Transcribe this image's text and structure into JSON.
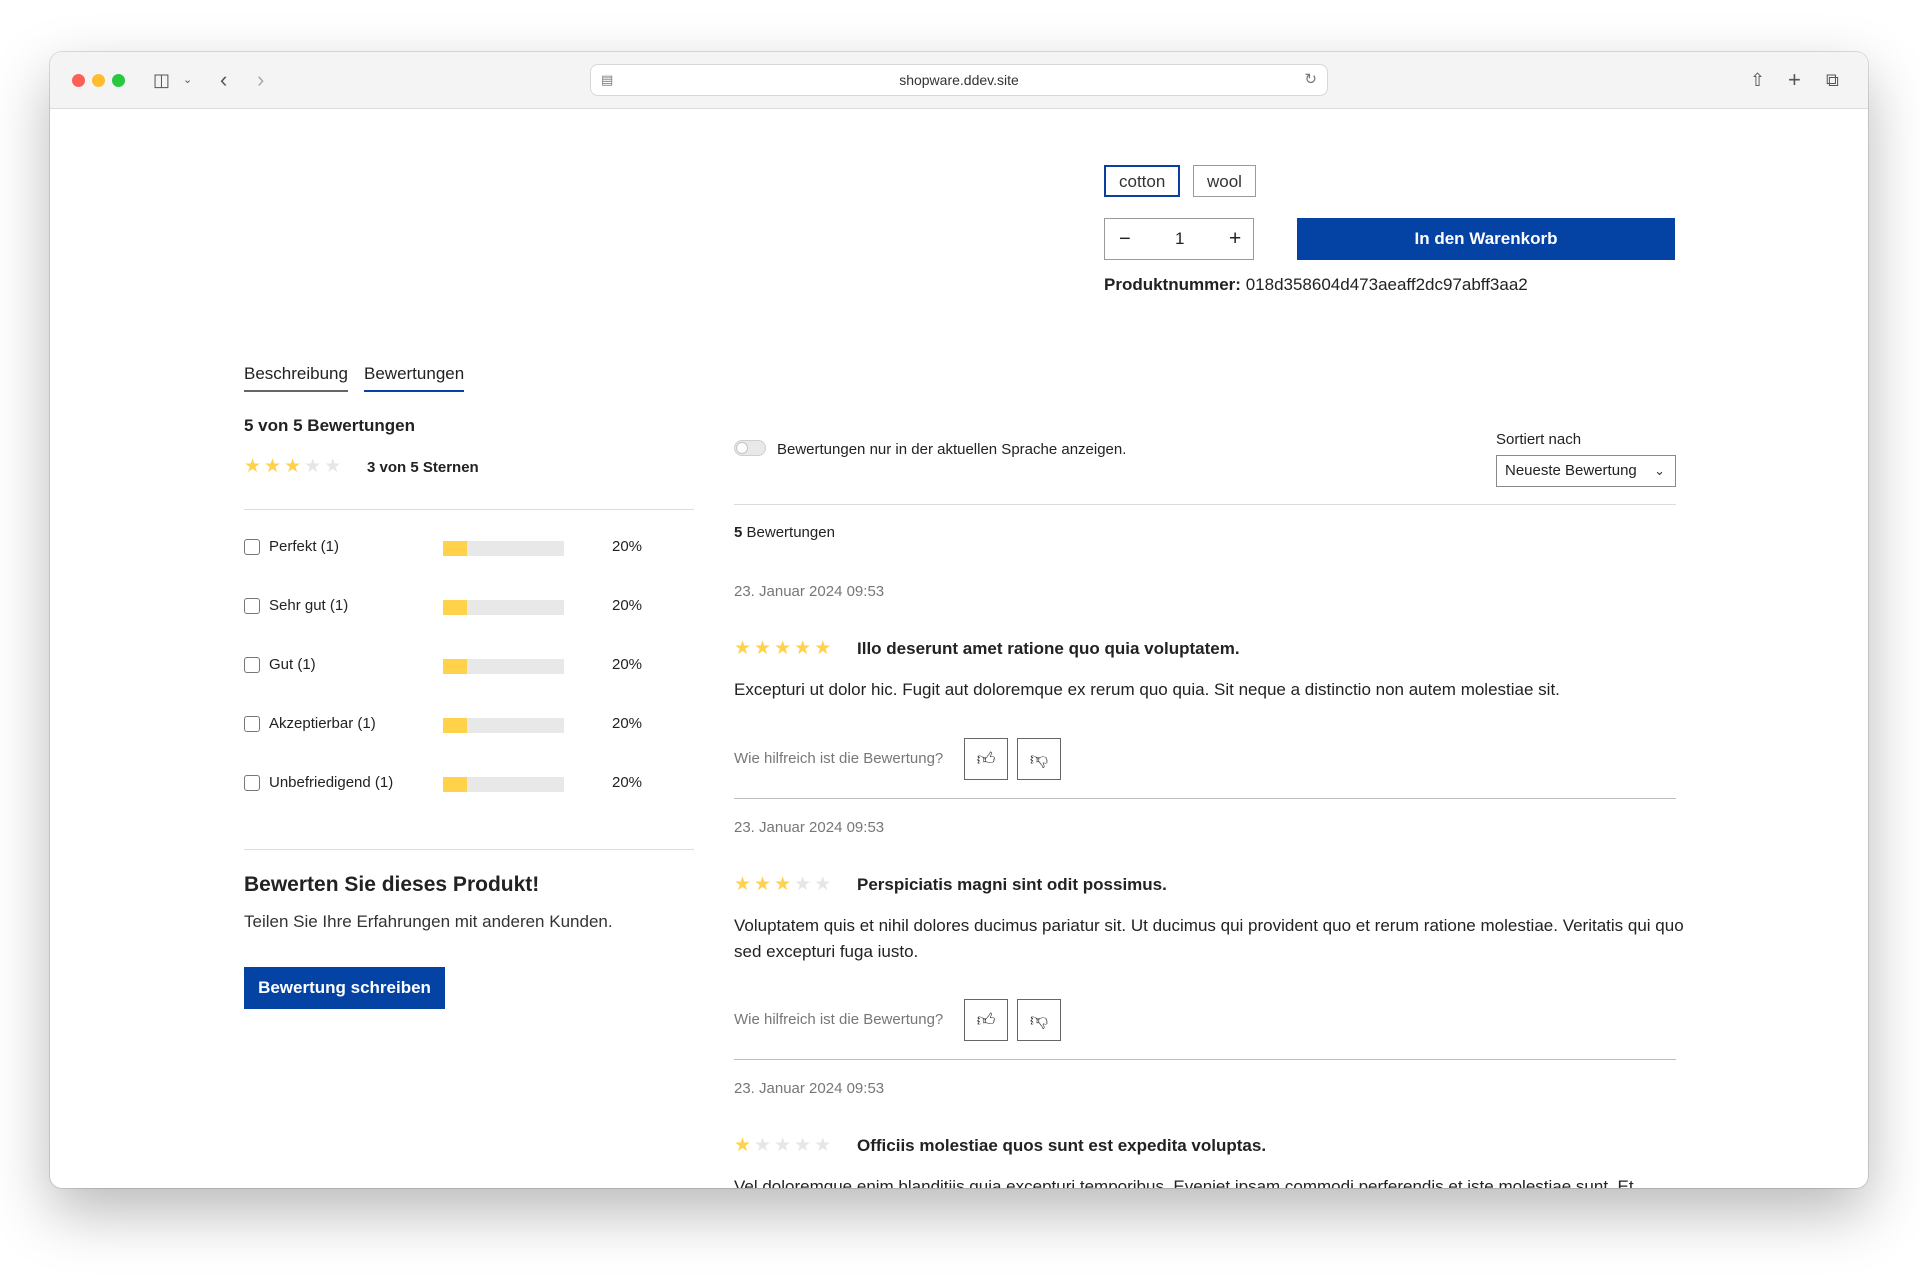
{
  "browser": {
    "url": "shopware.ddev.site"
  },
  "product": {
    "options": [
      "cotton",
      "wool"
    ],
    "quantity": "1",
    "qty_minus": "−",
    "qty_plus": "+",
    "add_to_cart": "In den Warenkorb",
    "product_number_label": "Produktnummer:",
    "product_number": "018d358604d473aeaff2dc97abff3aa2"
  },
  "tabs": {
    "description": "Beschreibung",
    "reviews": "Bewertungen"
  },
  "summary": {
    "title": "5 von 5 Bewertungen",
    "rating_text": "3 von 5 Sternen",
    "rating_value": 3,
    "filters": [
      {
        "label": "Perfekt (1)",
        "percent": "20%",
        "fraction": 0.2
      },
      {
        "label": "Sehr gut (1)",
        "percent": "20%",
        "fraction": 0.2
      },
      {
        "label": "Gut (1)",
        "percent": "20%",
        "fraction": 0.2
      },
      {
        "label": "Akzeptierbar (1)",
        "percent": "20%",
        "fraction": 0.2
      },
      {
        "label": "Unbefriedigend (1)",
        "percent": "20%",
        "fraction": 0.2
      }
    ]
  },
  "cta": {
    "title": "Bewerten Sie dieses Produkt!",
    "text": "Teilen Sie Ihre Erfahrungen mit anderen Kunden.",
    "button": "Bewertung schreiben"
  },
  "review_list": {
    "language_toggle_label": "Bewertungen nur in der aktuellen Sprache anzeigen.",
    "sort_label": "Sortiert nach",
    "sort_value": "Neueste Bewertung",
    "count_number": "5",
    "count_label": " Bewertungen",
    "helpful_label": "Wie hilfreich ist die Bewertung?",
    "reviews": [
      {
        "date": "23. Januar 2024 09:53",
        "rating": 5,
        "title": "Illo deserunt amet ratione quo quia voluptatem.",
        "body": "Excepturi ut dolor hic. Fugit aut doloremque ex rerum quo quia. Sit neque a distinctio non autem molestiae sit."
      },
      {
        "date": "23. Januar 2024 09:53",
        "rating": 3,
        "title": "Perspiciatis magni sint odit possimus.",
        "body": "Voluptatem quis et nihil dolores ducimus pariatur sit. Ut ducimus qui provident quo et rerum ratione molestiae. Veritatis qui quo sed excepturi fuga iusto."
      },
      {
        "date": "23. Januar 2024 09:53",
        "rating": 1,
        "title": "Officiis molestiae quos sunt est expedita voluptas.",
        "body": "Vel doloremque enim blanditiis quia excepturi temporibus. Eveniet ipsam commodi perferendis et iste molestiae sunt. Et quaerat aut sequi. Consequatur consectetur nemo doloribus."
      }
    ]
  },
  "colors": {
    "primary": "#0442a4",
    "star": "#ffd24a",
    "star_empty": "#e6e6e6"
  }
}
